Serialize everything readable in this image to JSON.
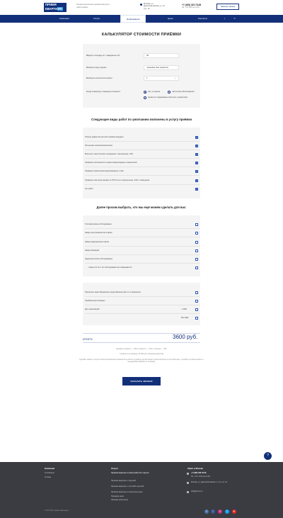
{
  "header": {
    "logo_line1": "ПРИМЯ",
    "logo_line2": "КВАРТИ",
    "logo_ru": "РУ",
    "tagline": "Профессиональная приемка квартир в новостройках",
    "address": "Москва, ул. Дорогомиловская, д. 14, стр. 14",
    "phone": "+7 (495) 323 78-08",
    "phone_hours": "Пн - Сб 9:00 до 21:00",
    "call_button": "Заказать звонок"
  },
  "nav": {
    "items": [
      "Компания",
      "Услуги",
      "Информация",
      "Цены",
      "Контакты"
    ],
    "active_index": 2
  },
  "calc": {
    "title": "КАЛЬКУЛЯТОР СТОИМОСТИ ПРИЁМКИ",
    "area_label": "Введите площадь (в т. квадратных м)*",
    "area_value": "40",
    "type_label": "Выберите вид отделки",
    "type_value": "черновая (без ремонта)",
    "rooms_label": "Выберите количество комнат",
    "rooms_value": "1",
    "furniture_label": "Когда в квартиру планируете въехать?",
    "furniture_options": [
      "Нет, я отделки",
      "Частичная (обои/ламинат)",
      "Нужно (по содержанию обычного и ремонтом)"
    ]
  },
  "included": {
    "title": "Следующие виды работ по умолчанию включены в услугу приёмки",
    "items": [
      "Осмотр дефектов для акта приёма-передачи",
      "Испытание окон/окосоконтактов",
      "Монитор и акустические ограждения, температура, СЭС",
      "Проверка отклонений от нормы водопроводных показателей",
      "Проверка ограничения водопроводных и свет",
      "Проверка электроустановок по ПУЭ сети и подключение, АЭС и освещение",
      "Акт работ"
    ]
  },
  "optional": {
    "title": "Далее просим выбрать, что мы ещё можем сделать для вас:",
    "items": [
      "Тепловизионное обследование",
      "Замер электромагнитного фона",
      "Замер радиационного фона",
      "Замер вибраций",
      "Эндоскопическое обследование",
      "Нужно ли этот тип обследования вы заказываете?"
    ]
  },
  "extras": {
    "items": [
      "Присылать ваше Временное представление фото и отправление",
      "Приёмка многоэтажных",
      "Для организаций"
    ],
    "values": [
      "",
      "",
      "+ 4400",
      "Без НДС"
    ]
  },
  "total": {
    "label": "ИТОГО:",
    "value": "3600 руб."
  },
  "notes": {
    "line1": "Базовая стоимость — 80% стоимости — 70% от объема — 70%",
    "line2": "Стоимость на приёмку: 40 000 руб. (приёмка дефектов)",
    "line3": "Сделайте заявку и получите бесплатный вызов специалиста на объект в удобное для вас время и прочие вопросы по итоговой цене, уточняйте до начала работы с менеджером компании по телефону.",
    "order_button": "ЗАКАЗАТЬ ЗВОНОК"
  },
  "footer": {
    "col1_title": "Компания",
    "col1_links": [
      "О компании",
      "Отзывы"
    ],
    "col2_title": "Услуги",
    "col2_links": [
      "Приёмка квартиры в новостройке без отделки",
      "Приёмка квартиры с отделкой",
      "Приёмка квартиры с чистовой отделкой",
      "Приёмка квартиры в вторичном рынке",
      "Проверка дома",
      "Приёмка новостроек"
    ],
    "col3_title": "Офис в Москве",
    "phone": "+7 (495) 323 78-08",
    "phone_hours": "Пн - Сб с 9:00 до 21:00",
    "address": "Москва, ул. Дорогомиловская, д. 14, стр. 14",
    "email": "info@primet.ru",
    "copyright": "© 2017 Все права защищены",
    "social": [
      "vk",
      "f",
      "ig",
      "tw",
      "yt"
    ]
  },
  "colors": {
    "brand": "#12307a",
    "accent": "#2a56b5",
    "footer": "#3a3c42"
  }
}
